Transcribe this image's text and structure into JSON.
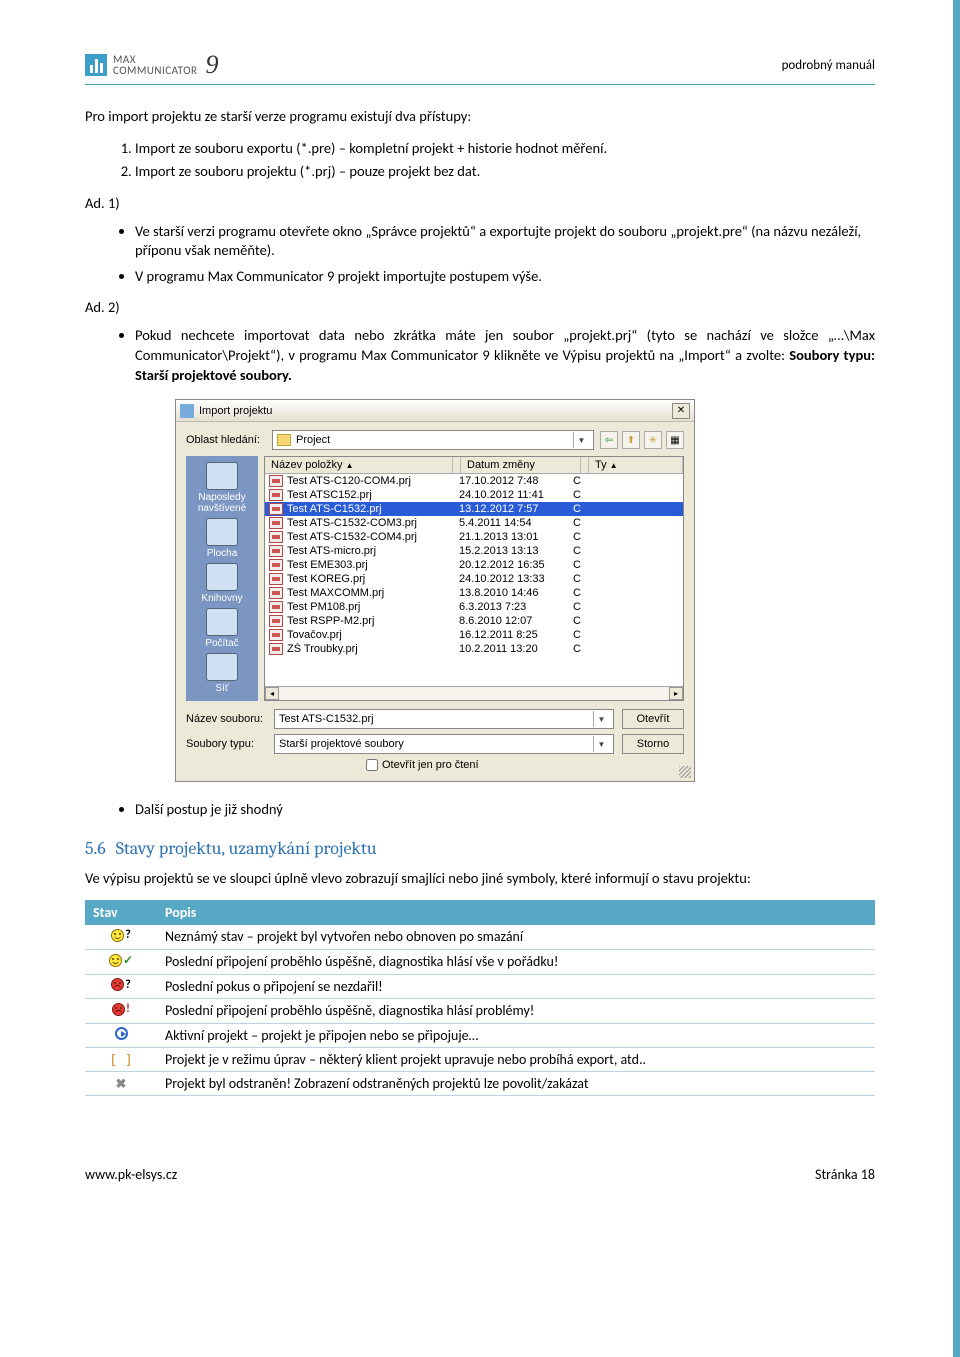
{
  "header": {
    "logo_line1": "MAX",
    "logo_line2": "COMMUNICATOR",
    "logo_num": "9",
    "manual": "podrobný manuál"
  },
  "intro": "Pro import projektu ze starší verze programu existují dva přístupy:",
  "numlist": [
    "Import ze souboru exportu (*.pre) – kompletní projekt + historie hodnot měření.",
    "Import ze souboru projektu (*.prj) – pouze projekt bez dat."
  ],
  "ad1_label": "Ad. 1)",
  "ad1_items": [
    "Ve starší verzi programu otevřete okno „Správce projektů“ a exportujte projekt do souboru „projekt.pre“ (na názvu nezáleží, příponu však neměňte).",
    "V programu Max Communicator 9 projekt importujte postupem výše."
  ],
  "ad2_label": "Ad. 2)",
  "ad2_item": "Pokud nechcete importovat data nebo zkrátka máte jen soubor „projekt.prj“ (tyto se nachází ve složce „…\\Max Communicator\\Projekt“), v programu Max Communicator 9 klikněte ve Výpisu projektů na „Import“ a zvolte: Soubory typu: Starší projektové soubory.",
  "dialog": {
    "title": "Import projektu",
    "search_label": "Oblast hledání:",
    "search_value": "Project",
    "col_name": "Název položky",
    "col_date": "Datum změny",
    "col_type": "Ty",
    "sidebar": [
      "Naposledy navštívené",
      "Plocha",
      "Knihovny",
      "Počítač",
      "Síť"
    ],
    "files": [
      {
        "n": "Test ATS-C120-COM4.prj",
        "d": "17.10.2012 7:48",
        "t": "C"
      },
      {
        "n": "Test ATSC152.prj",
        "d": "24.10.2012 11:41",
        "t": "C"
      },
      {
        "n": "Test ATS-C1532.prj",
        "d": "13.12.2012 7:57",
        "t": "C",
        "sel": true
      },
      {
        "n": "Test ATS-C1532-COM3.prj",
        "d": "5.4.2011 14:54",
        "t": "C"
      },
      {
        "n": "Test ATS-C1532-COM4.prj",
        "d": "21.1.2013 13:01",
        "t": "C"
      },
      {
        "n": "Test ATS-micro.prj",
        "d": "15.2.2013 13:13",
        "t": "C"
      },
      {
        "n": "Test EME303.prj",
        "d": "20.12.2012 16:35",
        "t": "C"
      },
      {
        "n": "Test KOREG.prj",
        "d": "24.10.2012 13:33",
        "t": "C"
      },
      {
        "n": "Test MAXCOMM.prj",
        "d": "13.8.2010 14:46",
        "t": "C"
      },
      {
        "n": "Test PM108.prj",
        "d": "6.3.2013 7:23",
        "t": "C"
      },
      {
        "n": "Test RSPP-M2.prj",
        "d": "8.6.2010 12:07",
        "t": "C"
      },
      {
        "n": "Tovačov.prj",
        "d": "16.12.2011 8:25",
        "t": "C"
      },
      {
        "n": "ZŠ Troubky.prj",
        "d": "10.2.2011 13:20",
        "t": "C"
      }
    ],
    "fname_label": "Název souboru:",
    "fname_value": "Test ATS-C1532.prj",
    "ftype_label": "Soubory typu:",
    "ftype_value": "Starší projektové soubory",
    "btn_open": "Otevřít",
    "btn_cancel": "Storno",
    "readonly": "Otevřít jen pro čtení"
  },
  "post_item": "Další postup je již shodný",
  "section": {
    "num": "5.6",
    "title": "Stavy projektu, uzamykání projektu",
    "text": "Ve výpisu projektů se ve sloupci úplně vlevo zobrazují smajlíci nebo jiné symboly, které informují o stavu projektu:"
  },
  "table": {
    "h1": "Stav",
    "h2": "Popis",
    "rows": [
      "Neznámý stav – projekt byl vytvořen nebo obnoven po smazání",
      "Poslední připojení proběhlo úspěšně, diagnostika hlásí vše v pořádku!",
      "Poslední pokus o připojení se nezdařil!",
      "Poslední připojení proběhlo úspěšně, diagnostika hlásí problémy!",
      "Aktivní projekt – projekt je připojen nebo se připojuje…",
      "Projekt je v režimu úprav – některý klient projekt upravuje nebo probíhá export, atd..",
      "Projekt byl odstraněn! Zobrazení odstraněných projektů lze povolit/zakázat"
    ]
  },
  "footer": {
    "url": "www.pk-elsys.cz",
    "page": "Stránka 18"
  }
}
